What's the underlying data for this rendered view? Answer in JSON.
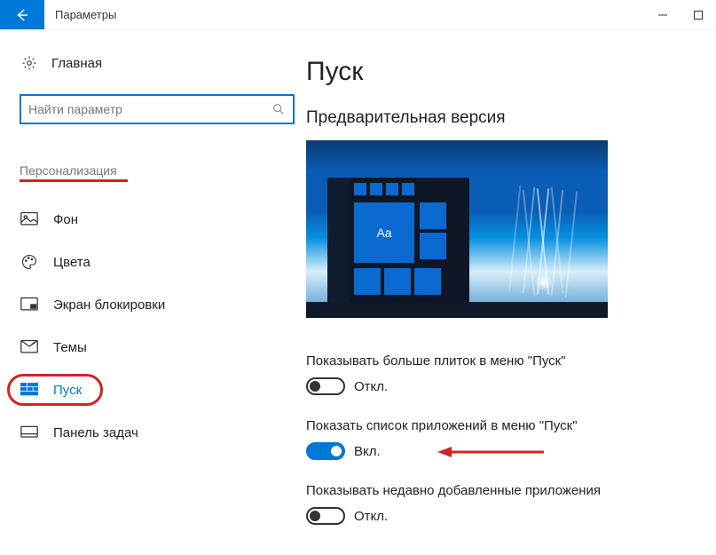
{
  "window": {
    "title": "Параметры"
  },
  "sidebar": {
    "home": "Главная",
    "search_placeholder": "Найти параметр",
    "category": "Персонализация",
    "items": [
      {
        "label": "Фон"
      },
      {
        "label": "Цвета"
      },
      {
        "label": "Экран блокировки"
      },
      {
        "label": "Темы"
      },
      {
        "label": "Пуск"
      },
      {
        "label": "Панель задач"
      }
    ]
  },
  "main": {
    "heading": "Пуск",
    "subheading": "Предварительная версия",
    "preview_tile_text": "Aa",
    "settings": [
      {
        "label": "Показывать больше плиток в меню \"Пуск\"",
        "on": false,
        "state_text": "Откл."
      },
      {
        "label": "Показать список приложений в меню \"Пуск\"",
        "on": true,
        "state_text": "Вкл."
      },
      {
        "label": "Показывать недавно добавленные приложения",
        "on": false,
        "state_text": "Откл."
      }
    ]
  },
  "colors": {
    "accent": "#0078d7",
    "annotation": "#d02424"
  }
}
